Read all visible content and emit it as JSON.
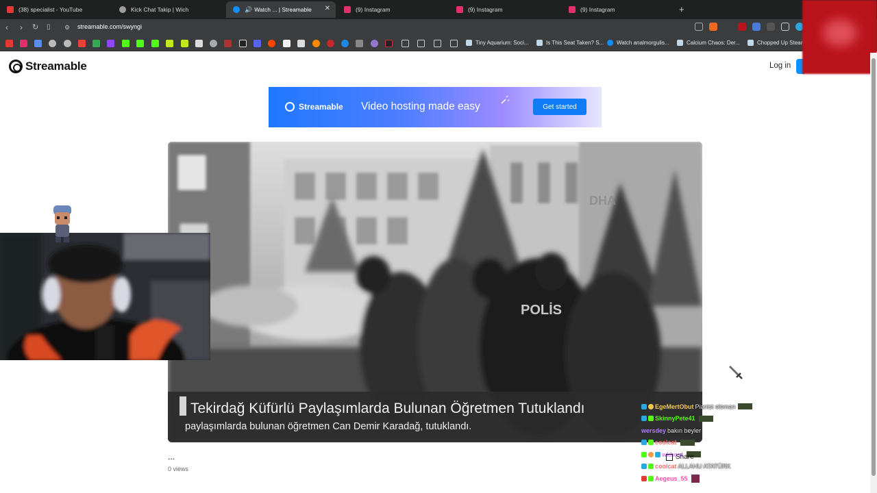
{
  "browser": {
    "tabs": [
      {
        "title": "(38) specialist - YouTube",
        "favicon": "youtube-icon",
        "color": "#e53935"
      },
      {
        "title": "Kick Chat Takip | Wich",
        "favicon": "globe-icon",
        "color": "#9e9e9e"
      },
      {
        "title": "Watch ... | Streamable",
        "favicon": "streamable-icon",
        "color": "#0f90fa",
        "active": true
      },
      {
        "title": "(9) Instagram",
        "favicon": "instagram-icon",
        "color": "#e1306c"
      },
      {
        "title": "(9) Instagram",
        "favicon": "instagram-icon",
        "color": "#e1306c"
      },
      {
        "title": "(9) Instagram",
        "favicon": "instagram-icon",
        "color": "#e1306c"
      }
    ],
    "new_tab": "+",
    "url": "streamable.com/swyngi",
    "bookmarks": [
      {
        "label": "Tiny Aquarium: Soci..."
      },
      {
        "label": "Is This Seat Taken? S..."
      },
      {
        "label": "Watch analmorgulis..."
      },
      {
        "label": "Calcium Chaos: Der..."
      },
      {
        "label": "Chopped Up Steam"
      }
    ]
  },
  "site": {
    "brand": "Streamable",
    "login": "Log in",
    "banner": {
      "brand": "Streamable",
      "tagline": "Video hosting made easy",
      "cta": "Get started"
    }
  },
  "video": {
    "watermark": "DHA",
    "caption_title": "Tekirdağ Küfürlü Paylaşımlarda Bulunan Öğretmen Tutuklandı",
    "caption_sub": "paylaşımlarda bulunan öğretmen Can Demir Karadağ, tutuklandı.",
    "vest_text": "POLİS"
  },
  "meta": {
    "title": "...",
    "views": "0 views",
    "share": "Share"
  },
  "chat": [
    {
      "user": "EgeMertObut",
      "message": "Pianist eleman",
      "color": "#f2c94c"
    },
    {
      "user": "SkinnyPete41",
      "message": "",
      "color": "#53fc18"
    },
    {
      "user": "wersdey",
      "message": "bakın beyler",
      "color": "#b07cff"
    },
    {
      "user": "coolcat",
      "message": "",
      "color": "#ff6b6b"
    },
    {
      "user": "wkhost",
      "message": "",
      "color": "#c77dff"
    },
    {
      "user": "coolcat",
      "message": "ALLAHU ATATÜRK",
      "color": "#ff6b6b"
    },
    {
      "user": "Aegeus_55",
      "message": "",
      "color": "#ff4fa3"
    }
  ]
}
